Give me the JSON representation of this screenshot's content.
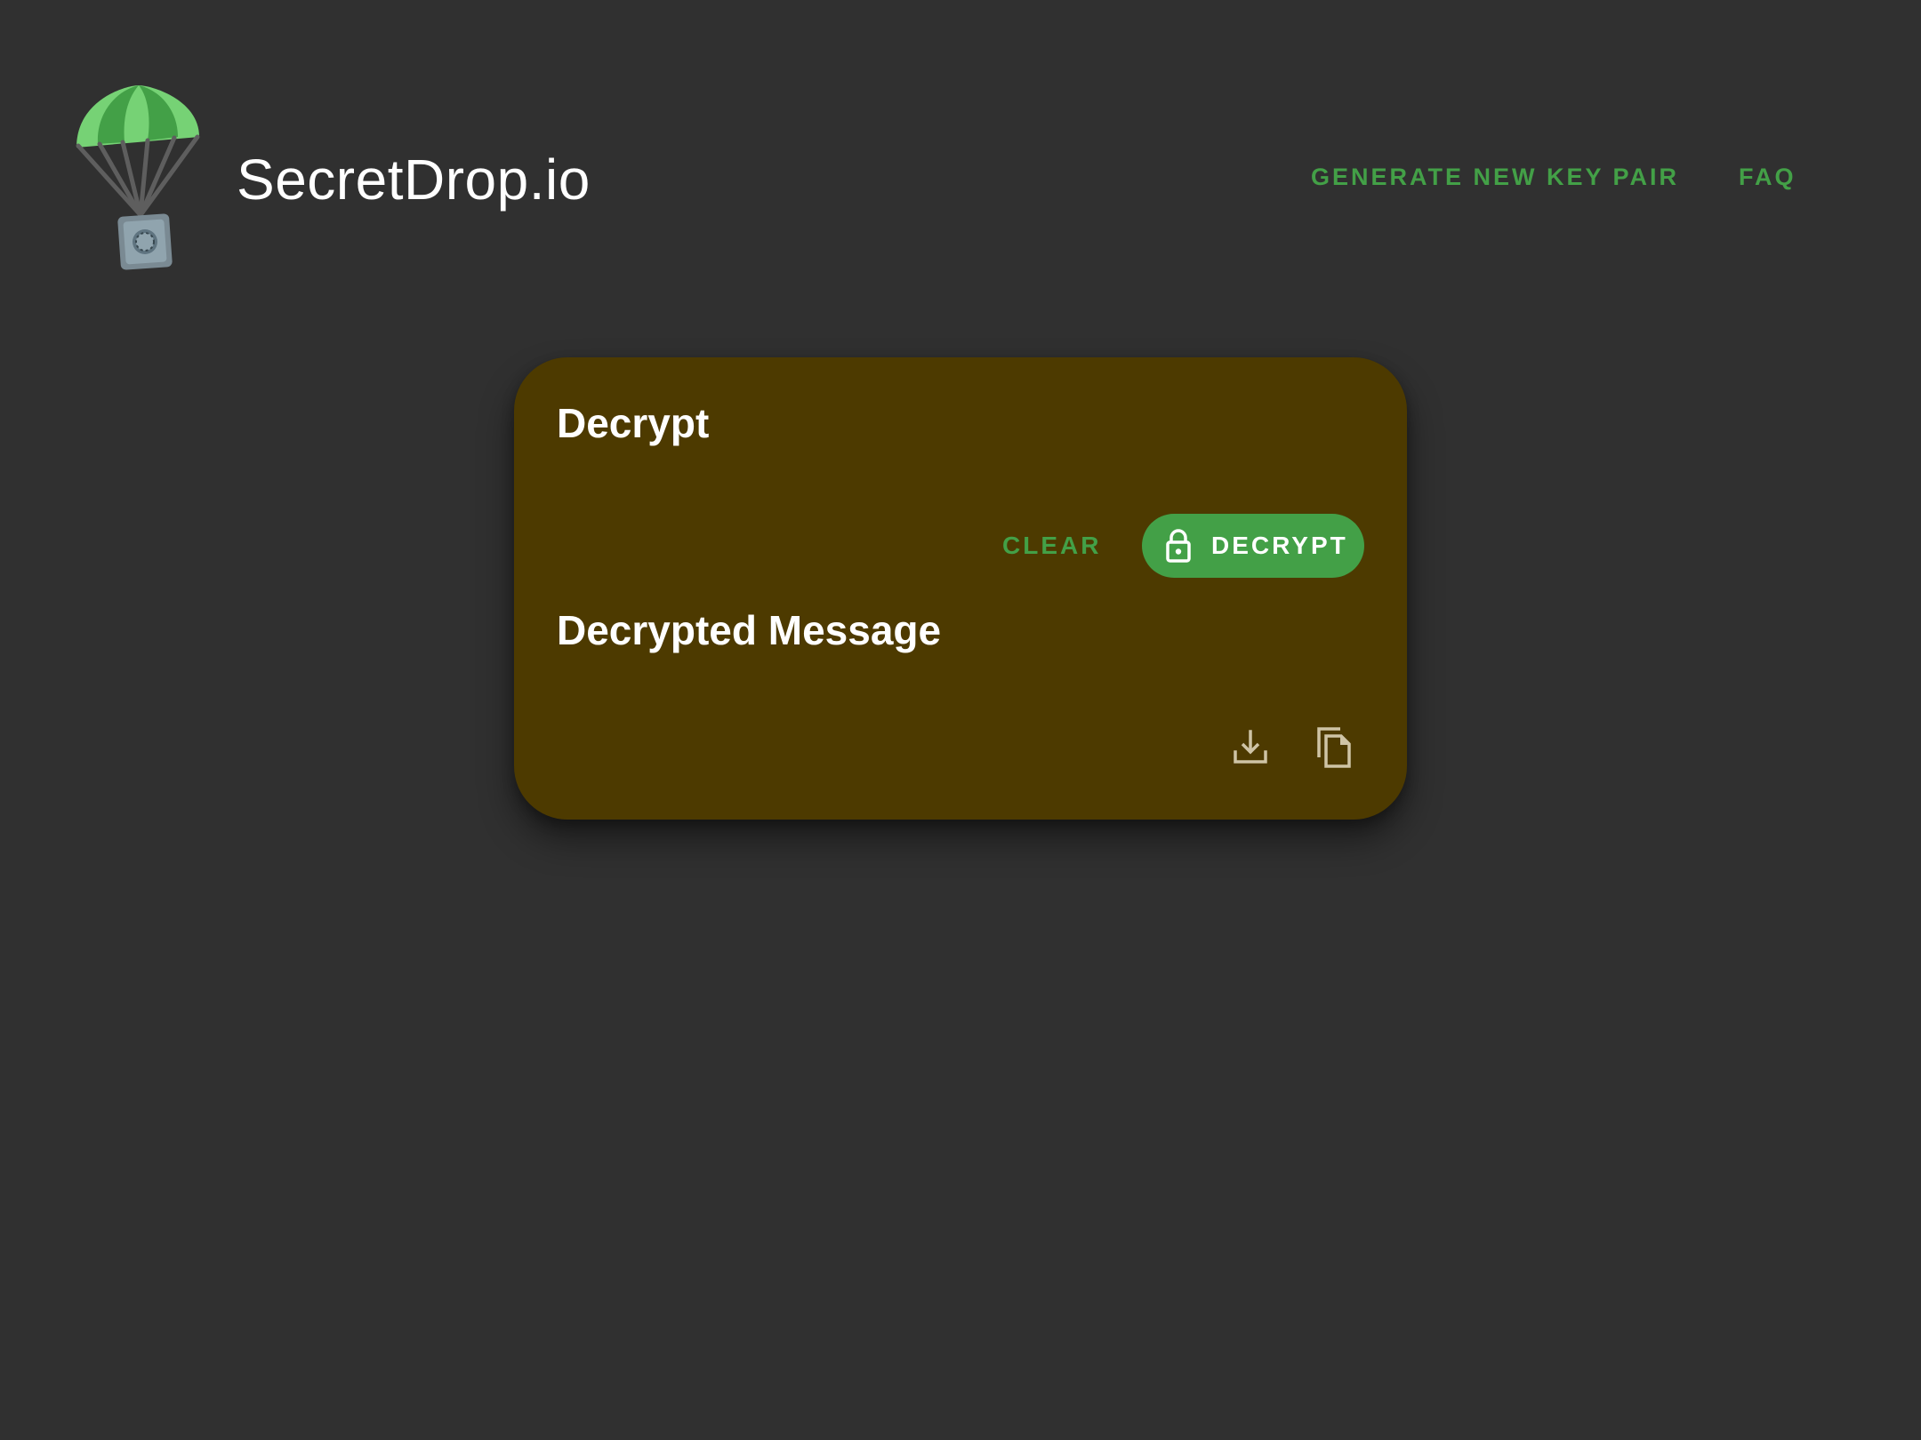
{
  "header": {
    "site_title": "SecretDrop.io",
    "logo_icon": "parachute-safe-icon",
    "nav": {
      "generate_label": "GENERATE NEW KEY PAIR",
      "faq_label": "FAQ"
    }
  },
  "card": {
    "decrypt_heading": "Decrypt",
    "clear_label": "CLEAR",
    "decrypt_button_label": "DECRYPT",
    "decrypt_button_icon": "lock-icon",
    "message_heading": "Decrypted Message",
    "download_icon": "download-icon",
    "copy_icon": "copy-icon"
  },
  "colors": {
    "background": "#303030",
    "card_background": "#4d3a00",
    "accent": "#43a047",
    "text": "#ffffff",
    "icon": "#cfc4a6"
  }
}
